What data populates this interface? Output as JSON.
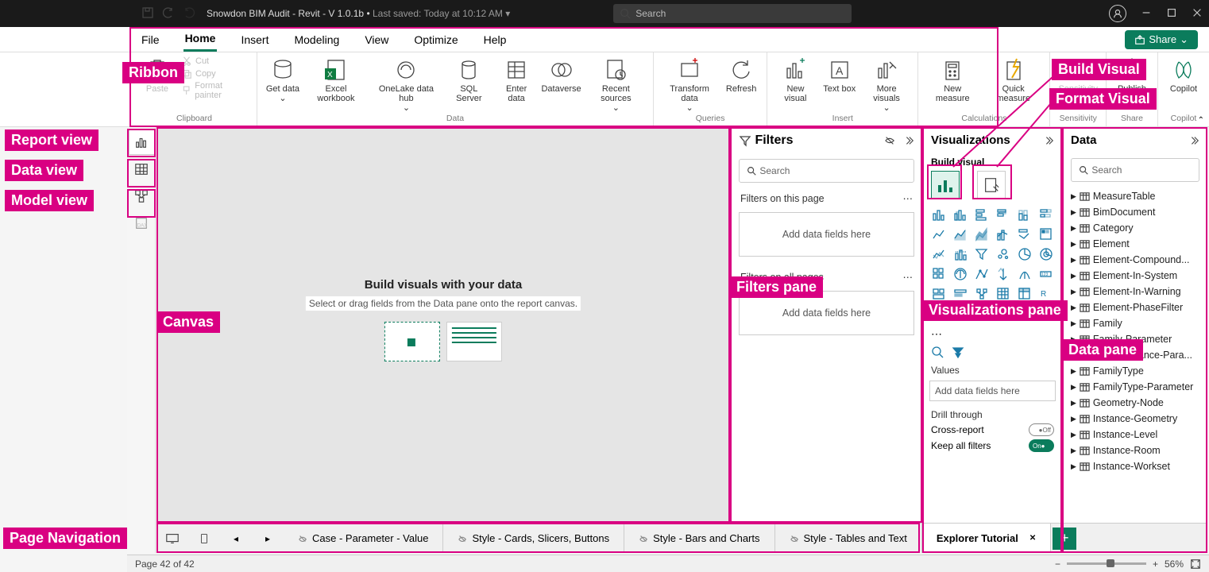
{
  "titlebar": {
    "title_main": "Snowdon BIM Audit - Revit - V 1.0.1b",
    "title_saved": "Last saved: Today at 10:12 AM",
    "search_placeholder": "Search"
  },
  "tabs": {
    "file": "File",
    "home": "Home",
    "insert": "Insert",
    "modeling": "Modeling",
    "view": "View",
    "optimize": "Optimize",
    "help": "Help",
    "share": "Share"
  },
  "ribbon": {
    "clipboard": {
      "paste": "Paste",
      "cut": "Cut",
      "copy": "Copy",
      "format_painter": "Format painter",
      "label": "Clipboard"
    },
    "data": {
      "get_data": "Get data",
      "excel": "Excel workbook",
      "onelake": "OneLake data hub",
      "sql": "SQL Server",
      "enter": "Enter data",
      "dataverse": "Dataverse",
      "recent": "Recent sources",
      "label": "Data"
    },
    "queries": {
      "transform": "Transform data",
      "refresh": "Refresh",
      "label": "Queries"
    },
    "insert": {
      "new_visual": "New visual",
      "text_box": "Text box",
      "more": "More visuals",
      "label": "Insert"
    },
    "calc": {
      "new_measure": "New measure",
      "quick": "Quick measure",
      "label": "Calculations"
    },
    "sens": {
      "sensitivity": "Sensitivity",
      "label": "Sensitivity"
    },
    "share": {
      "publish": "Publish",
      "label": "Share"
    },
    "copilot": {
      "copilot": "Copilot",
      "label": "Copilot"
    }
  },
  "canvas": {
    "heading": "Build visuals with your data",
    "sub": "Select or drag fields from the Data pane onto the report canvas."
  },
  "filters": {
    "title": "Filters",
    "search": "Search",
    "on_page": "Filters on this page",
    "add": "Add data fields here",
    "all": "Filters on all pages"
  },
  "viz": {
    "title": "Visualizations",
    "sub": "Build visual",
    "values": "Values",
    "add": "Add data fields here",
    "drill": "Drill through",
    "cross": "Cross-report",
    "keep": "Keep all filters",
    "off": "Off",
    "on": "On"
  },
  "data_pane": {
    "title": "Data",
    "search": "Search",
    "tables": [
      "MeasureTable",
      "BimDocument",
      "Category",
      "Element",
      "Element-Compound...",
      "Element-In-System",
      "Element-In-Warning",
      "Element-PhaseFilter",
      "Family",
      "Family-Parameter",
      "FamilyInstance-Para...",
      "FamilyType",
      "FamilyType-Parameter",
      "Geometry-Node",
      "Instance-Geometry",
      "Instance-Level",
      "Instance-Room",
      "Instance-Workset"
    ]
  },
  "pages": {
    "tabs": [
      "Case - Parameter - Value",
      "Style - Cards, Slicers, Buttons",
      "Style - Bars and Charts",
      "Style - Tables and Text",
      "Explorer Tutorial"
    ]
  },
  "status": {
    "page": "Page 42 of 42",
    "zoom": "56%"
  },
  "annotations": {
    "ribbon": "Ribbon",
    "report": "Report view",
    "datav": "Data view",
    "modelv": "Model view",
    "canvas": "Canvas",
    "filters": "Filters pane",
    "viz": "Visualizations pane",
    "datap": "Data pane",
    "build": "Build Visual",
    "format": "Format Visual",
    "pnav": "Page Navigation"
  }
}
